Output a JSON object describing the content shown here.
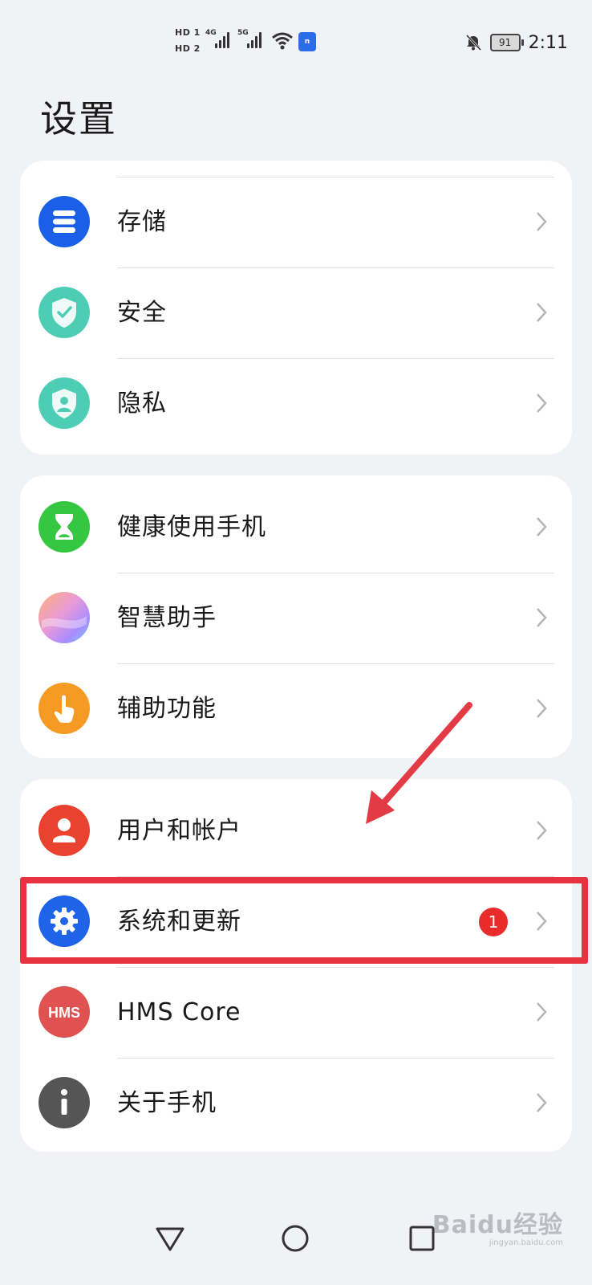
{
  "status_bar": {
    "sim1": "HD 1",
    "sim2": "HD 2",
    "net1": "4G",
    "net2": "5G",
    "hotspot_label": "n",
    "battery": "91",
    "time": "2:11"
  },
  "page_title": "设置",
  "groups": [
    {
      "items": [
        {
          "label": "存储",
          "icon": "storage-icon",
          "color": "#1a5fe8"
        },
        {
          "label": "安全",
          "icon": "security-shield-icon",
          "color": "#4ecdb5"
        },
        {
          "label": "隐私",
          "icon": "privacy-shield-icon",
          "color": "#4ecdb5"
        }
      ]
    },
    {
      "items": [
        {
          "label": "健康使用手机",
          "icon": "hourglass-icon",
          "color": "#35c742"
        },
        {
          "label": "智慧助手",
          "icon": "assistant-orb-icon",
          "color": "#c6a6ff"
        },
        {
          "label": "辅助功能",
          "icon": "accessibility-hand-icon",
          "color": "#f59a23"
        }
      ]
    },
    {
      "items": [
        {
          "label": "用户和帐户",
          "icon": "user-icon",
          "color": "#e94330"
        },
        {
          "label": "系统和更新",
          "icon": "gear-icon",
          "color": "#1f63e8",
          "badge": "1"
        },
        {
          "label": "HMS Core",
          "icon": "hms-core-icon",
          "color": "#e05252"
        },
        {
          "label": "关于手机",
          "icon": "info-icon",
          "color": "#555555"
        }
      ]
    }
  ],
  "hms_icon_text": "HMS",
  "watermark": {
    "main": "Baidu经验",
    "sub": "jingyan.baidu.com"
  }
}
